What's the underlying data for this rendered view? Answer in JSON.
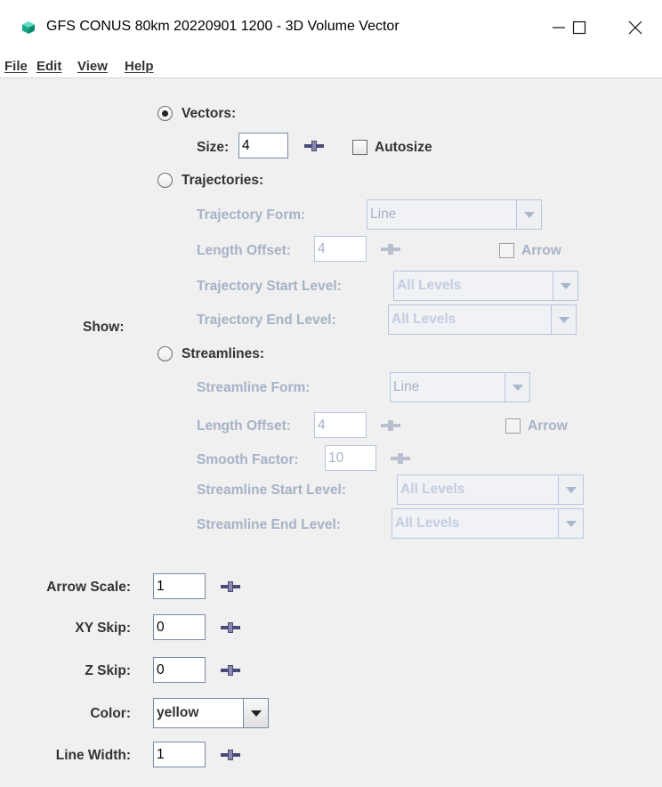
{
  "window": {
    "title": "GFS CONUS 80km 20220901 1200 - 3D Volume Vector",
    "controls": [
      "minimize",
      "maximize",
      "close"
    ]
  },
  "menu": [
    "File",
    "Edit",
    "View",
    "Help"
  ],
  "show": {
    "label": "Show:",
    "vectors": {
      "label": "Vectors:",
      "selected": true,
      "size_label": "Size:",
      "size_value": "4",
      "autosize_label": "Autosize",
      "autosize_checked": false
    },
    "trajectories": {
      "label": "Trajectories:",
      "selected": false,
      "form_label": "Trajectory Form:",
      "form_value": "Line",
      "length_offset_label": "Length Offset:",
      "length_offset_value": "4",
      "arrow_label": "Arrow",
      "start_level_label": "Trajectory Start Level:",
      "start_level_value": "All Levels",
      "end_level_label": "Trajectory End Level:",
      "end_level_value": "All Levels"
    },
    "streamlines": {
      "label": "Streamlines:",
      "selected": false,
      "form_label": "Streamline Form:",
      "form_value": "Line",
      "length_offset_label": "Length Offset:",
      "length_offset_value": "4",
      "arrow_label": "Arrow",
      "smooth_label": "Smooth Factor:",
      "smooth_value": "10",
      "start_level_label": "Streamline Start Level:",
      "start_level_value": "All Levels",
      "end_level_label": "Streamline End Level:",
      "end_level_value": "All Levels"
    }
  },
  "arrow_scale": {
    "label": "Arrow Scale:",
    "value": "1"
  },
  "xy_skip": {
    "label": "XY Skip:",
    "value": "0"
  },
  "z_skip": {
    "label": "Z Skip:",
    "value": "0"
  },
  "color": {
    "label": "Color:",
    "value": "yellow"
  },
  "line_width": {
    "label": "Line Width:",
    "value": "1"
  },
  "colors": {
    "enabled_text": "#333333",
    "disabled_text": "#a6b2c6",
    "slider_enabled": "#4a4a78",
    "slider_disabled": "#b8c0cf",
    "app_icon": "#1fbf9a"
  }
}
